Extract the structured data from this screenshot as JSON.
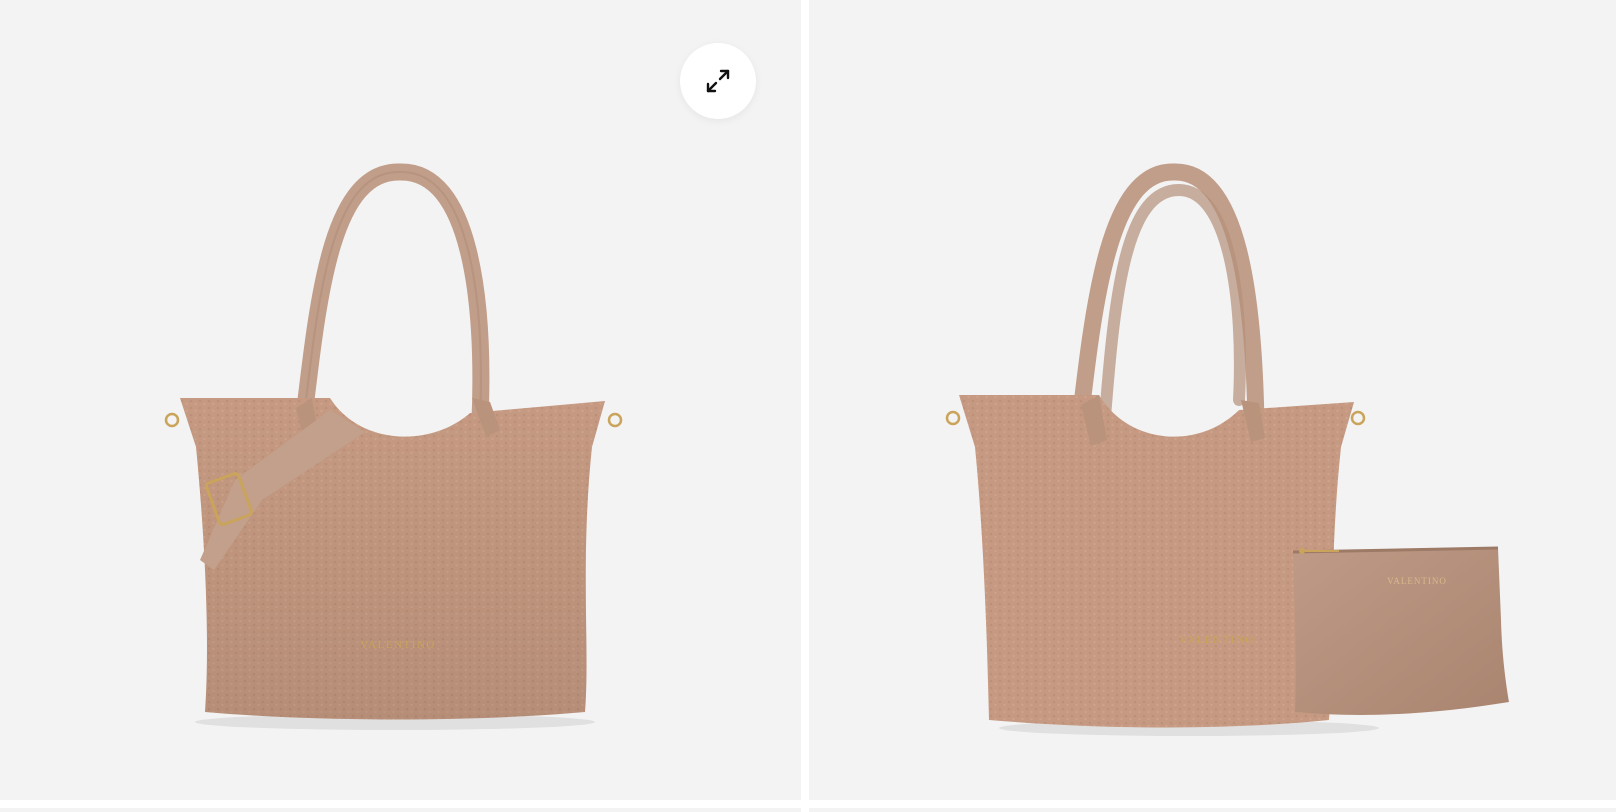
{
  "gallery": {
    "images": [
      {
        "alt": "",
        "brand_mark": "VALENTINO"
      },
      {
        "alt": "",
        "brand_mark": "VALENTINO",
        "pouch_mark": "VALENTINO"
      }
    ],
    "expand_button": {
      "icon": "expand-arrows-icon"
    }
  },
  "colors": {
    "background": "#f3f3f4",
    "bag": "#c69a82",
    "handle": "#c19e89",
    "hardware": "#c9a45a",
    "pouch": "#b38f7c"
  }
}
